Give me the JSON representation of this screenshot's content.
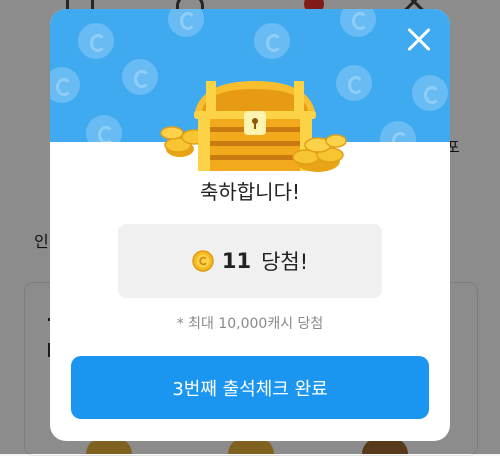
{
  "background_app": {
    "left_fragment": "인",
    "right_fragment": "포"
  },
  "modal": {
    "icons": {
      "close": "close-icon",
      "reward": "treasure-chest-icon",
      "coin": "coin-icon"
    },
    "title": "축하합니다!",
    "prize": {
      "amount": "11",
      "suffix": "당첨!"
    },
    "note": "* 최대 10,000캐시 당첨",
    "cta_label": "3번째 출석체크 완료"
  },
  "colors": {
    "header_blue": "#3faaf0",
    "button_blue": "#1a96f0",
    "coin_gold": "#f5b921"
  }
}
